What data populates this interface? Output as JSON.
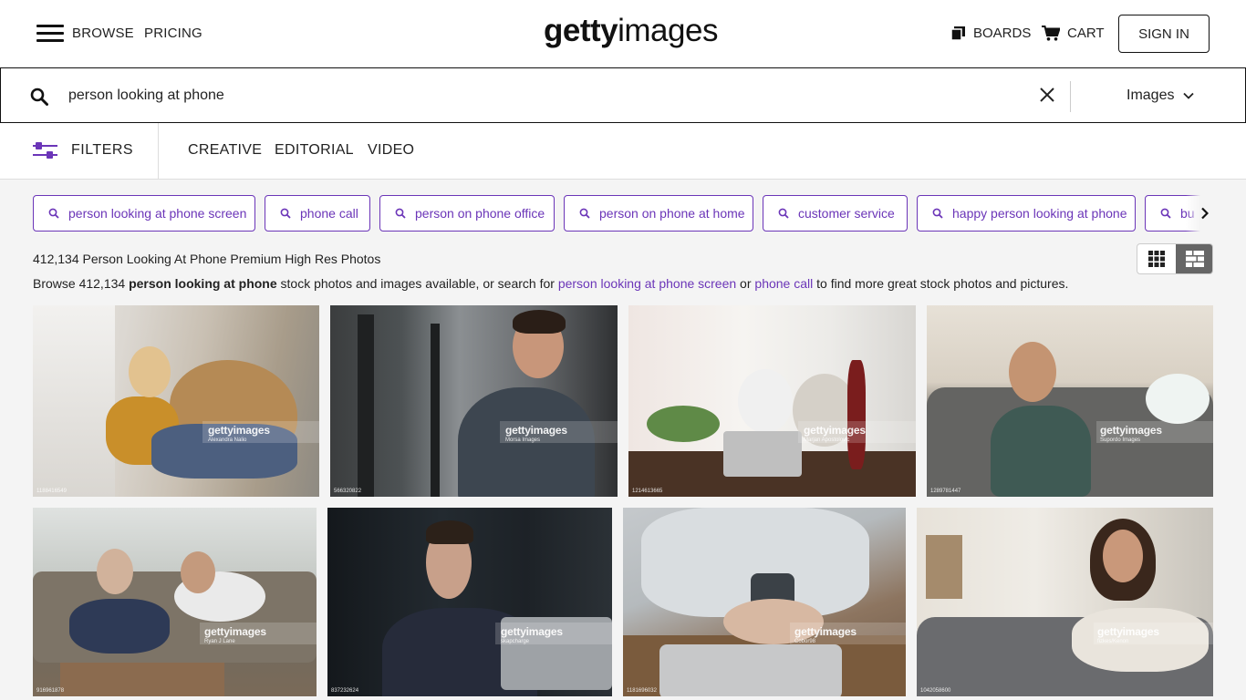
{
  "header": {
    "browse": "BROWSE",
    "pricing": "PRICING",
    "logo_bold": "getty",
    "logo_thin": "images",
    "boards": "BOARDS",
    "cart": "CART",
    "sign_in": "SIGN IN"
  },
  "search": {
    "value": "person looking at phone",
    "type_selected": "Images"
  },
  "filters": {
    "label": "FILTERS",
    "tabs": [
      "CREATIVE",
      "EDITORIAL",
      "VIDEO"
    ]
  },
  "chips": [
    "person looking at phone screen",
    "phone call",
    "person on phone office",
    "person on phone at home",
    "customer service",
    "happy person looking at phone",
    "bu"
  ],
  "results": {
    "count_line": "412,134 Person Looking At Phone Premium High Res Photos",
    "desc_prefix": "Browse 412,134 ",
    "desc_bold": "person looking at phone",
    "desc_mid": " stock photos and images available, or search for ",
    "desc_link1": "person looking at phone screen",
    "desc_or": " or ",
    "desc_link2": "phone call",
    "desc_suffix": " to find more great stock photos and pictures."
  },
  "watermark": "gettyimages",
  "images": [
    {
      "credit": "Alexandra Nalio",
      "id": "1188416549"
    },
    {
      "credit": "Morsa Images",
      "id": "566320822"
    },
    {
      "credit": "Marjan Apostolovic",
      "id": "1214613665"
    },
    {
      "credit": "Supordo Images",
      "id": "1289781447"
    },
    {
      "credit": "Ryan J Lane",
      "id": "916961878"
    },
    {
      "credit": "skapcharge",
      "id": "837232624"
    },
    {
      "credit": "Cobor98",
      "id": "1181696032"
    },
    {
      "credit": "fizkes/Kenon",
      "id": "1042058600"
    }
  ],
  "colors": {
    "accent": "#6b35b8",
    "background": "#f4f4f4"
  }
}
